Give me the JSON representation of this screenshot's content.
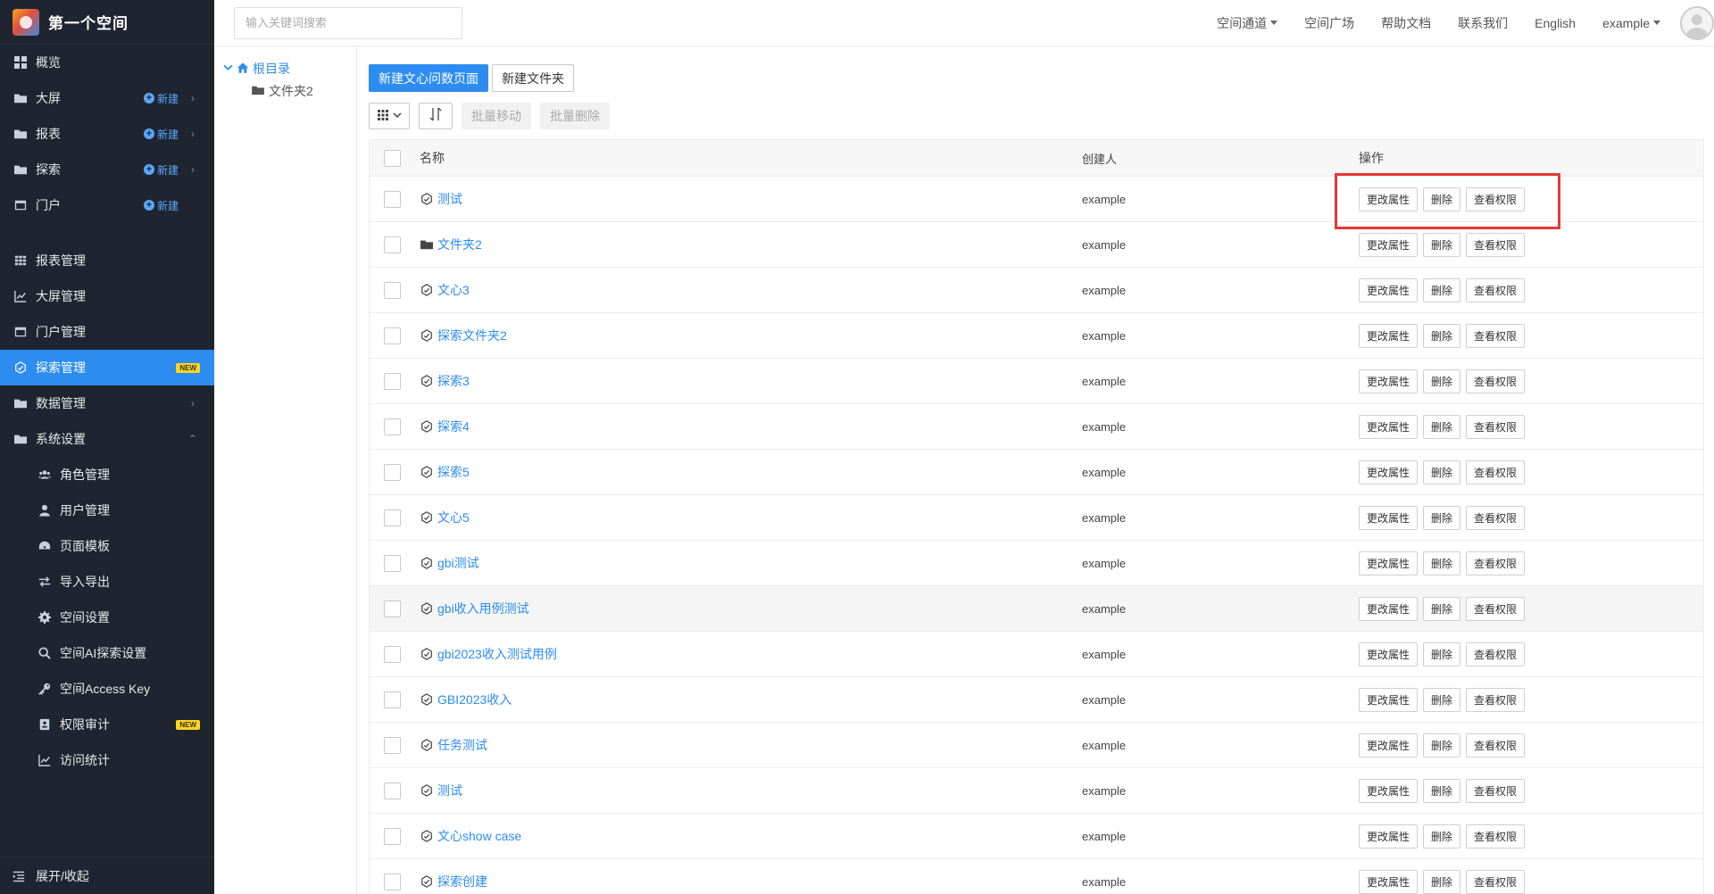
{
  "app": {
    "title": "第一个空间"
  },
  "sidebar": {
    "items": [
      {
        "label": "概览",
        "icon": "grid-icon",
        "new_label": "",
        "chevron": ""
      },
      {
        "label": "大屏",
        "icon": "folder-icon",
        "new_label": "新建",
        "chevron": "›"
      },
      {
        "label": "报表",
        "icon": "folder-icon",
        "new_label": "新建",
        "chevron": "›"
      },
      {
        "label": "探索",
        "icon": "folder-icon",
        "new_label": "新建",
        "chevron": "›"
      },
      {
        "label": "门户",
        "icon": "window-icon",
        "new_label": "新建",
        "chevron": ""
      }
    ],
    "manage_items": [
      {
        "label": "报表管理",
        "icon": "table-icon"
      },
      {
        "label": "大屏管理",
        "icon": "line-chart-icon"
      },
      {
        "label": "门户管理",
        "icon": "window-icon"
      },
      {
        "label": "探索管理",
        "icon": "explore-icon",
        "badge": "NEW",
        "active": true
      },
      {
        "label": "数据管理",
        "icon": "folder-icon",
        "chevron": "›"
      },
      {
        "label": "系统设置",
        "icon": "folder-icon",
        "chevron": "⌃"
      }
    ],
    "settings_items": [
      {
        "label": "角色管理",
        "icon": "users-icon"
      },
      {
        "label": "用户管理",
        "icon": "user-icon"
      },
      {
        "label": "页面模板",
        "icon": "dashboard-icon"
      },
      {
        "label": "导入导出",
        "icon": "exchange-icon"
      },
      {
        "label": "空间设置",
        "icon": "gear-icon"
      },
      {
        "label": "空间AI探索设置",
        "icon": "search-icon"
      },
      {
        "label": "空间Access Key",
        "icon": "key-icon"
      },
      {
        "label": "权限审计",
        "icon": "id-card-icon",
        "badge": "NEW"
      },
      {
        "label": "访问统计",
        "icon": "line-chart-icon"
      }
    ],
    "footer_label": "展开/收起"
  },
  "header": {
    "search_placeholder": "输入关键词搜索",
    "links": [
      {
        "label": "空间通道",
        "caret": true
      },
      {
        "label": "空间广场",
        "caret": false
      },
      {
        "label": "帮助文档",
        "caret": false
      },
      {
        "label": "联系我们",
        "caret": false
      },
      {
        "label": "English",
        "caret": false
      },
      {
        "label": "example",
        "caret": true
      }
    ]
  },
  "tree": {
    "root_label": "根目录",
    "children": [
      "文件夹2"
    ]
  },
  "toolbar": {
    "new_page_label": "新建文心问数页面",
    "new_folder_label": "新建文件夹",
    "batch_move_label": "批量移动",
    "batch_delete_label": "批量删除"
  },
  "table": {
    "headers": {
      "name": "名称",
      "owner": "创建人",
      "ops": "操作"
    },
    "op_labels": [
      "更改属性",
      "删除",
      "查看权限"
    ],
    "rows": [
      {
        "name": "测试",
        "type": "explore",
        "owner": "example"
      },
      {
        "name": "文件夹2",
        "type": "folder",
        "owner": "example"
      },
      {
        "name": "文心3",
        "type": "explore",
        "owner": "example"
      },
      {
        "name": "探索文件夹2",
        "type": "explore",
        "owner": "example"
      },
      {
        "name": "探索3",
        "type": "explore",
        "owner": "example"
      },
      {
        "name": "探索4",
        "type": "explore",
        "owner": "example"
      },
      {
        "name": "探索5",
        "type": "explore",
        "owner": "example"
      },
      {
        "name": "文心5",
        "type": "explore",
        "owner": "example"
      },
      {
        "name": "gbi测试",
        "type": "explore",
        "owner": "example"
      },
      {
        "name": "gbi收入用例测试",
        "type": "explore",
        "owner": "example",
        "hover": true
      },
      {
        "name": "gbi2023收入测试用例",
        "type": "explore",
        "owner": "example"
      },
      {
        "name": "GBI2023收入",
        "type": "explore",
        "owner": "example"
      },
      {
        "name": "任务测试",
        "type": "explore",
        "owner": "example"
      },
      {
        "name": "测试",
        "type": "explore",
        "owner": "example"
      },
      {
        "name": "文心show case",
        "type": "explore",
        "owner": "example"
      },
      {
        "name": "探索创建",
        "type": "explore",
        "owner": "example"
      }
    ]
  },
  "colors": {
    "sidebar_bg": "#1f2530",
    "accent": "#2d8cf0",
    "badge": "#ffd51a",
    "highlight": "#e53935"
  }
}
